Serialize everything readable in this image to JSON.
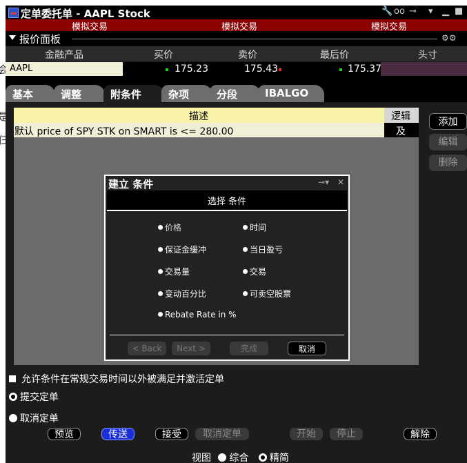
{
  "window": {
    "title": "定单委托单 - AAPL Stock",
    "sim_labels": [
      "模拟交易",
      "模拟交易",
      "模拟交易"
    ]
  },
  "quote_panel": {
    "label": "报价面板",
    "columns": [
      "金融产品",
      "买价",
      "卖价",
      "最后价",
      "头寸"
    ],
    "row": {
      "symbol": "AAPL",
      "bid": "175.23",
      "ask": "175.43",
      "last": "175.37",
      "position": ""
    }
  },
  "tabs": [
    {
      "label": "基本"
    },
    {
      "label": "调整"
    },
    {
      "label": "附条件",
      "selected": true
    },
    {
      "label": "杂项"
    },
    {
      "label": "分段"
    },
    {
      "label": "IBALGO"
    }
  ],
  "conditions": {
    "header_desc": "描述",
    "header_logic": "逻辑",
    "rows": [
      {
        "desc": "默认 price of SPY STK on SMART is <= 280.00",
        "logic": "及"
      }
    ],
    "side_buttons": {
      "add": "添加",
      "edit": "编辑",
      "delete": "删除"
    }
  },
  "dialog": {
    "title": "建立 条件",
    "subtitle": "选择 条件",
    "options_left": [
      "价格",
      "保证金缓冲",
      "交易量",
      "变动百分比",
      "Rebate Rate in %"
    ],
    "options_right": [
      "时间",
      "当日盈亏",
      "交易",
      "可卖空股票"
    ],
    "selected": "价格",
    "buttons": {
      "back": "< Back",
      "next": "Next >",
      "finish": "完成",
      "cancel": "取消"
    }
  },
  "options": {
    "allow_outside_rth": "允许条件在常规交易时间以外被满足并激活定单",
    "submit_order": "提交定单",
    "cancel_order": "取消定单"
  },
  "bottom_buttons": {
    "preview": "预览",
    "transmit": "传送",
    "accept": "接受",
    "cancel_order": "取消定单",
    "start": "开始",
    "stop": "停止",
    "release": "解除"
  },
  "view": {
    "label": "视图",
    "comprehensive": "综合",
    "concise": "精简"
  },
  "colors": {
    "sim_bar": "#8b0000",
    "selected_tab": "#1e1e1e",
    "transmit_blue": "#1a2fd8"
  }
}
